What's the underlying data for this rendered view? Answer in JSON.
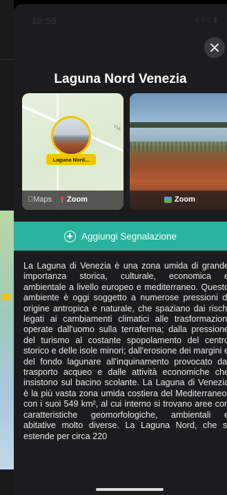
{
  "status_bar": {
    "time": "10:55",
    "right": "…ıl 5G ▮"
  },
  "sheet": {
    "title": "Laguna Nord Venezia",
    "close_icon": "close-icon"
  },
  "cards": {
    "map": {
      "pin_label": "Laguna Nord...",
      "road_label": "VIA",
      "maps_brand": "Maps",
      "zoom_label": "Zoom"
    },
    "photo": {
      "zoom_label": "Zoom"
    }
  },
  "action": {
    "label": "Aggiungi Segnalazione",
    "icon": "plus-circle-icon"
  },
  "description": "La Laguna di Venezia è una zona umida di grande importanza storica, culturale, economica e ambientale a livello europeo e mediterraneo. Questo ambiente è oggi soggetto a numerose pressioni di origine antropica e naturale, che spaziano dai rischi legati ai cambiamenti climatici alle trasformazioni operate dall'uomo sulla terraferma; dalla pressione del turismo al costante spopolamento del centro storico e delle isole minori; dall'erosione dei margini e del fondo lagunare all'inquinamento provocato dal trasporto acqueo e dalle attività economiche che insistono sul bacino scolante. La Laguna di Venezia è la più vasta zona umida costiera del Mediterraneo, con i suoi 549 km², al cui interno si trovano aree con caratteristiche geomorfologiche, ambientali e abitative molto diverse. La Laguna Nord, che si estende per circa 220",
  "colors": {
    "accent": "#27b39e",
    "sheet_bg": "#1c1c1e",
    "pin_yellow": "#f2c500"
  }
}
